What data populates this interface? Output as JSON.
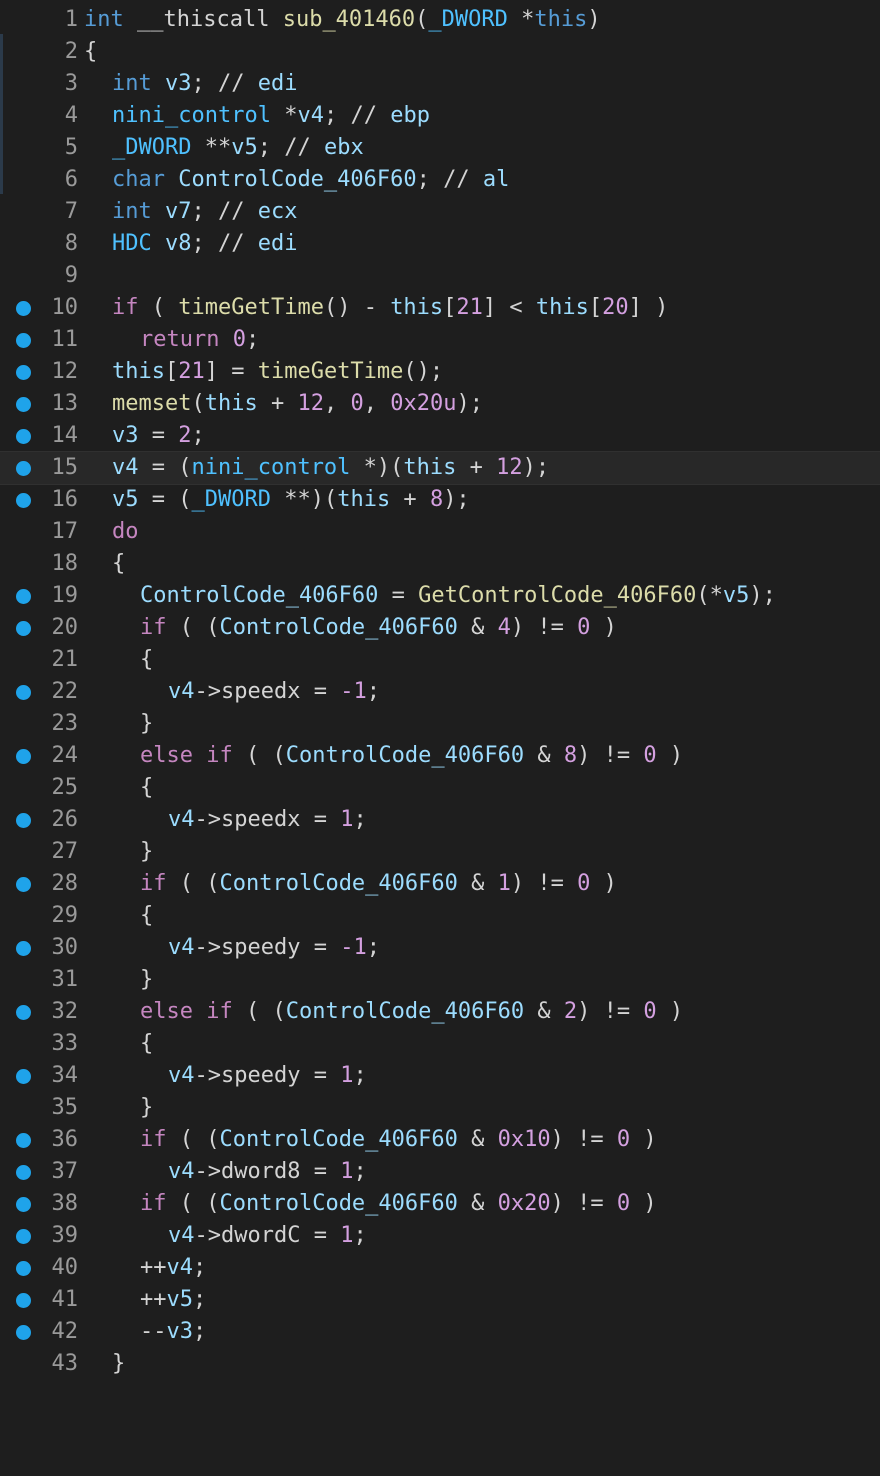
{
  "editor": {
    "lines": [
      {
        "n": "1",
        "bp": false,
        "indent": 0,
        "tokens": [
          [
            "kw",
            "int"
          ],
          [
            "op",
            " __thiscall "
          ],
          [
            "fn",
            "sub_401460"
          ],
          [
            "op",
            "("
          ],
          [
            "typ",
            "_DWORD"
          ],
          [
            "op",
            " *"
          ],
          [
            "kw",
            "this"
          ],
          [
            "op",
            ")"
          ]
        ]
      },
      {
        "n": "2",
        "bp": false,
        "indent": 0,
        "tokens": [
          [
            "op",
            "{"
          ]
        ]
      },
      {
        "n": "3",
        "bp": false,
        "indent": 1,
        "tokens": [
          [
            "kw",
            "int"
          ],
          [
            "op",
            " "
          ],
          [
            "var",
            "v3"
          ],
          [
            "op",
            "; "
          ],
          [
            "cm",
            "// "
          ],
          [
            "reg",
            "edi"
          ]
        ]
      },
      {
        "n": "4",
        "bp": false,
        "indent": 1,
        "tokens": [
          [
            "typ",
            "nini_control"
          ],
          [
            "op",
            " *"
          ],
          [
            "var",
            "v4"
          ],
          [
            "op",
            "; "
          ],
          [
            "cm",
            "// "
          ],
          [
            "reg",
            "ebp"
          ]
        ]
      },
      {
        "n": "5",
        "bp": false,
        "indent": 1,
        "tokens": [
          [
            "typ",
            "_DWORD"
          ],
          [
            "op",
            " **"
          ],
          [
            "var",
            "v5"
          ],
          [
            "op",
            "; "
          ],
          [
            "cm",
            "// "
          ],
          [
            "reg",
            "ebx"
          ]
        ]
      },
      {
        "n": "6",
        "bp": false,
        "indent": 1,
        "tokens": [
          [
            "kw",
            "char"
          ],
          [
            "op",
            " "
          ],
          [
            "var",
            "ControlCode_406F60"
          ],
          [
            "op",
            "; "
          ],
          [
            "cm",
            "// "
          ],
          [
            "reg",
            "al"
          ]
        ]
      },
      {
        "n": "7",
        "bp": false,
        "indent": 1,
        "tokens": [
          [
            "kw",
            "int"
          ],
          [
            "op",
            " "
          ],
          [
            "var",
            "v7"
          ],
          [
            "op",
            "; "
          ],
          [
            "cm",
            "// "
          ],
          [
            "reg",
            "ecx"
          ]
        ]
      },
      {
        "n": "8",
        "bp": false,
        "indent": 1,
        "tokens": [
          [
            "typ",
            "HDC"
          ],
          [
            "op",
            " "
          ],
          [
            "var",
            "v8"
          ],
          [
            "op",
            "; "
          ],
          [
            "cm",
            "// "
          ],
          [
            "reg",
            "edi"
          ]
        ]
      },
      {
        "n": "9",
        "bp": false,
        "indent": 0,
        "tokens": []
      },
      {
        "n": "10",
        "bp": true,
        "indent": 1,
        "tokens": [
          [
            "ctl",
            "if"
          ],
          [
            "op",
            " ( "
          ],
          [
            "fn",
            "timeGetTime"
          ],
          [
            "op",
            "() - "
          ],
          [
            "this",
            "this"
          ],
          [
            "op",
            "["
          ],
          [
            "num",
            "21"
          ],
          [
            "op",
            "] < "
          ],
          [
            "this",
            "this"
          ],
          [
            "op",
            "["
          ],
          [
            "num",
            "20"
          ],
          [
            "op",
            "] )"
          ]
        ]
      },
      {
        "n": "11",
        "bp": true,
        "indent": 2,
        "tokens": [
          [
            "ctl",
            "return"
          ],
          [
            "op",
            " "
          ],
          [
            "num",
            "0"
          ],
          [
            "op",
            ";"
          ]
        ]
      },
      {
        "n": "12",
        "bp": true,
        "indent": 1,
        "tokens": [
          [
            "this",
            "this"
          ],
          [
            "op",
            "["
          ],
          [
            "num",
            "21"
          ],
          [
            "op",
            "] = "
          ],
          [
            "fn",
            "timeGetTime"
          ],
          [
            "op",
            "();"
          ]
        ]
      },
      {
        "n": "13",
        "bp": true,
        "indent": 1,
        "tokens": [
          [
            "fn",
            "memset"
          ],
          [
            "op",
            "("
          ],
          [
            "this",
            "this"
          ],
          [
            "op",
            " + "
          ],
          [
            "num",
            "12"
          ],
          [
            "op",
            ", "
          ],
          [
            "num",
            "0"
          ],
          [
            "op",
            ", "
          ],
          [
            "num",
            "0x20u"
          ],
          [
            "op",
            ");"
          ]
        ]
      },
      {
        "n": "14",
        "bp": true,
        "indent": 1,
        "tokens": [
          [
            "var",
            "v3"
          ],
          [
            "op",
            " = "
          ],
          [
            "num",
            "2"
          ],
          [
            "op",
            ";"
          ]
        ]
      },
      {
        "n": "15",
        "bp": true,
        "indent": 1,
        "current": true,
        "tokens": [
          [
            "var",
            "v4"
          ],
          [
            "op",
            " = ("
          ],
          [
            "typ",
            "nini_control"
          ],
          [
            "op",
            " *)("
          ],
          [
            "this",
            "this"
          ],
          [
            "op",
            " + "
          ],
          [
            "num",
            "12"
          ],
          [
            "op",
            ");"
          ]
        ]
      },
      {
        "n": "16",
        "bp": true,
        "indent": 1,
        "tokens": [
          [
            "var",
            "v5"
          ],
          [
            "op",
            " = ("
          ],
          [
            "typ",
            "_DWORD"
          ],
          [
            "op",
            " **)("
          ],
          [
            "this",
            "this"
          ],
          [
            "op",
            " + "
          ],
          [
            "num",
            "8"
          ],
          [
            "op",
            ");"
          ]
        ]
      },
      {
        "n": "17",
        "bp": false,
        "indent": 1,
        "tokens": [
          [
            "ctl",
            "do"
          ]
        ]
      },
      {
        "n": "18",
        "bp": false,
        "indent": 1,
        "tokens": [
          [
            "op",
            "{"
          ]
        ]
      },
      {
        "n": "19",
        "bp": true,
        "indent": 2,
        "tokens": [
          [
            "var",
            "ControlCode_406F60"
          ],
          [
            "op",
            " = "
          ],
          [
            "fn",
            "GetControlCode_406F60"
          ],
          [
            "op",
            "(*"
          ],
          [
            "var",
            "v5"
          ],
          [
            "op",
            ");"
          ]
        ]
      },
      {
        "n": "20",
        "bp": true,
        "indent": 2,
        "tokens": [
          [
            "ctl",
            "if"
          ],
          [
            "op",
            " ( ("
          ],
          [
            "var",
            "ControlCode_406F60"
          ],
          [
            "op",
            " & "
          ],
          [
            "num",
            "4"
          ],
          [
            "op",
            ") != "
          ],
          [
            "num",
            "0"
          ],
          [
            "op",
            " )"
          ]
        ]
      },
      {
        "n": "21",
        "bp": false,
        "indent": 2,
        "tokens": [
          [
            "op",
            "{"
          ]
        ]
      },
      {
        "n": "22",
        "bp": true,
        "indent": 3,
        "tokens": [
          [
            "var",
            "v4"
          ],
          [
            "op",
            "->"
          ],
          [
            "fld",
            "speedx"
          ],
          [
            "op",
            " = "
          ],
          [
            "num",
            "-1"
          ],
          [
            "op",
            ";"
          ]
        ]
      },
      {
        "n": "23",
        "bp": false,
        "indent": 2,
        "tokens": [
          [
            "op",
            "}"
          ]
        ]
      },
      {
        "n": "24",
        "bp": true,
        "indent": 2,
        "tokens": [
          [
            "ctl",
            "else if"
          ],
          [
            "op",
            " ( ("
          ],
          [
            "var",
            "ControlCode_406F60"
          ],
          [
            "op",
            " & "
          ],
          [
            "num",
            "8"
          ],
          [
            "op",
            ") != "
          ],
          [
            "num",
            "0"
          ],
          [
            "op",
            " )"
          ]
        ]
      },
      {
        "n": "25",
        "bp": false,
        "indent": 2,
        "tokens": [
          [
            "op",
            "{"
          ]
        ]
      },
      {
        "n": "26",
        "bp": true,
        "indent": 3,
        "tokens": [
          [
            "var",
            "v4"
          ],
          [
            "op",
            "->"
          ],
          [
            "fld",
            "speedx"
          ],
          [
            "op",
            " = "
          ],
          [
            "num",
            "1"
          ],
          [
            "op",
            ";"
          ]
        ]
      },
      {
        "n": "27",
        "bp": false,
        "indent": 2,
        "tokens": [
          [
            "op",
            "}"
          ]
        ]
      },
      {
        "n": "28",
        "bp": true,
        "indent": 2,
        "tokens": [
          [
            "ctl",
            "if"
          ],
          [
            "op",
            " ( ("
          ],
          [
            "var",
            "ControlCode_406F60"
          ],
          [
            "op",
            " & "
          ],
          [
            "num",
            "1"
          ],
          [
            "op",
            ") != "
          ],
          [
            "num",
            "0"
          ],
          [
            "op",
            " )"
          ]
        ]
      },
      {
        "n": "29",
        "bp": false,
        "indent": 2,
        "tokens": [
          [
            "op",
            "{"
          ]
        ]
      },
      {
        "n": "30",
        "bp": true,
        "indent": 3,
        "tokens": [
          [
            "var",
            "v4"
          ],
          [
            "op",
            "->"
          ],
          [
            "fld",
            "speedy"
          ],
          [
            "op",
            " = "
          ],
          [
            "num",
            "-1"
          ],
          [
            "op",
            ";"
          ]
        ]
      },
      {
        "n": "31",
        "bp": false,
        "indent": 2,
        "tokens": [
          [
            "op",
            "}"
          ]
        ]
      },
      {
        "n": "32",
        "bp": true,
        "indent": 2,
        "tokens": [
          [
            "ctl",
            "else if"
          ],
          [
            "op",
            " ( ("
          ],
          [
            "var",
            "ControlCode_406F60"
          ],
          [
            "op",
            " & "
          ],
          [
            "num",
            "2"
          ],
          [
            "op",
            ") != "
          ],
          [
            "num",
            "0"
          ],
          [
            "op",
            " )"
          ]
        ]
      },
      {
        "n": "33",
        "bp": false,
        "indent": 2,
        "tokens": [
          [
            "op",
            "{"
          ]
        ]
      },
      {
        "n": "34",
        "bp": true,
        "indent": 3,
        "tokens": [
          [
            "var",
            "v4"
          ],
          [
            "op",
            "->"
          ],
          [
            "fld",
            "speedy"
          ],
          [
            "op",
            " = "
          ],
          [
            "num",
            "1"
          ],
          [
            "op",
            ";"
          ]
        ]
      },
      {
        "n": "35",
        "bp": false,
        "indent": 2,
        "tokens": [
          [
            "op",
            "}"
          ]
        ]
      },
      {
        "n": "36",
        "bp": true,
        "indent": 2,
        "tokens": [
          [
            "ctl",
            "if"
          ],
          [
            "op",
            " ( ("
          ],
          [
            "var",
            "ControlCode_406F60"
          ],
          [
            "op",
            " & "
          ],
          [
            "num",
            "0x10"
          ],
          [
            "op",
            ") != "
          ],
          [
            "num",
            "0"
          ],
          [
            "op",
            " )"
          ]
        ]
      },
      {
        "n": "37",
        "bp": true,
        "indent": 3,
        "tokens": [
          [
            "var",
            "v4"
          ],
          [
            "op",
            "->"
          ],
          [
            "fld",
            "dword8"
          ],
          [
            "op",
            " = "
          ],
          [
            "num",
            "1"
          ],
          [
            "op",
            ";"
          ]
        ]
      },
      {
        "n": "38",
        "bp": true,
        "indent": 2,
        "tokens": [
          [
            "ctl",
            "if"
          ],
          [
            "op",
            " ( ("
          ],
          [
            "var",
            "ControlCode_406F60"
          ],
          [
            "op",
            " & "
          ],
          [
            "num",
            "0x20"
          ],
          [
            "op",
            ") != "
          ],
          [
            "num",
            "0"
          ],
          [
            "op",
            " )"
          ]
        ]
      },
      {
        "n": "39",
        "bp": true,
        "indent": 3,
        "tokens": [
          [
            "var",
            "v4"
          ],
          [
            "op",
            "->"
          ],
          [
            "fld",
            "dwordC"
          ],
          [
            "op",
            " = "
          ],
          [
            "num",
            "1"
          ],
          [
            "op",
            ";"
          ]
        ]
      },
      {
        "n": "40",
        "bp": true,
        "indent": 2,
        "tokens": [
          [
            "op",
            "++"
          ],
          [
            "var",
            "v4"
          ],
          [
            "op",
            ";"
          ]
        ]
      },
      {
        "n": "41",
        "bp": true,
        "indent": 2,
        "tokens": [
          [
            "op",
            "++"
          ],
          [
            "var",
            "v5"
          ],
          [
            "op",
            ";"
          ]
        ]
      },
      {
        "n": "42",
        "bp": true,
        "indent": 2,
        "tokens": [
          [
            "op",
            "--"
          ],
          [
            "var",
            "v3"
          ],
          [
            "op",
            ";"
          ]
        ]
      },
      {
        "n": "43",
        "bp": false,
        "indent": 1,
        "tokens": [
          [
            "op",
            "}"
          ]
        ]
      }
    ]
  },
  "colors": {
    "background": "#1e1e1e",
    "breakpoint": "#1fa3ea",
    "line_number": "#9a9a9a",
    "keyword": "#569cd6",
    "control": "#c586c0",
    "type": "#4fc1ff",
    "variable": "#9cdcfe",
    "function": "#dcdcaa",
    "number": "#d4a0e0"
  }
}
